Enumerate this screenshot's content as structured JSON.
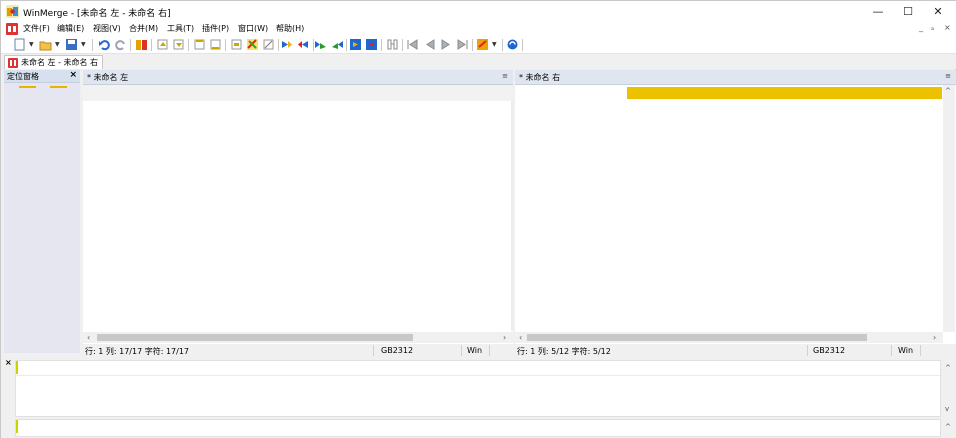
{
  "window": {
    "title": "WinMerge - [未命名 左 - 未命名 右]",
    "minimize": "—",
    "maximize": "☐",
    "close": "✕"
  },
  "menu": {
    "items": [
      "文件(F)",
      "编辑(E)",
      "视图(V)",
      "合并(M)",
      "工具(T)",
      "插件(P)",
      "窗口(W)",
      "帮助(H)"
    ],
    "mdi_controls": [
      "_",
      "ₐ",
      "×"
    ]
  },
  "toolbar": {
    "icons": [
      "new-icon",
      "open-icon",
      "save-icon",
      "undo-icon",
      "redo-icon",
      "compare-icon",
      "prev-diff-icon",
      "next-diff-icon",
      "first-diff-icon",
      "last-diff-icon",
      "current-diff-icon",
      "copy-right-icon",
      "copy-left-icon",
      "copy-all-right-icon",
      "copy-all-left-icon",
      "merge-icon",
      "delete-icon",
      "options-icon",
      "refresh-icon"
    ]
  },
  "tab": {
    "label": "未命名 左 - 未命名 右"
  },
  "location_pane": {
    "title": "定位窗格",
    "close": "×"
  },
  "left_pane": {
    "title": "* 未命名 左",
    "menu_glyph": "≡",
    "status": {
      "position": "行: 1  列: 17/17  字符: 17/17",
      "encoding": "GB2312",
      "eol": "Win"
    }
  },
  "right_pane": {
    "title": "* 未命名 右",
    "menu_glyph": "≡",
    "status": {
      "position": "行: 1  列: 5/12  字符: 5/12",
      "encoding": "GB2312",
      "eol": "Win"
    }
  },
  "colors": {
    "diff_highlight": "#ecc200",
    "pane_header": "#dfe6ef",
    "location_bg": "#e6e6f1"
  },
  "bottom": {
    "close": "×"
  }
}
